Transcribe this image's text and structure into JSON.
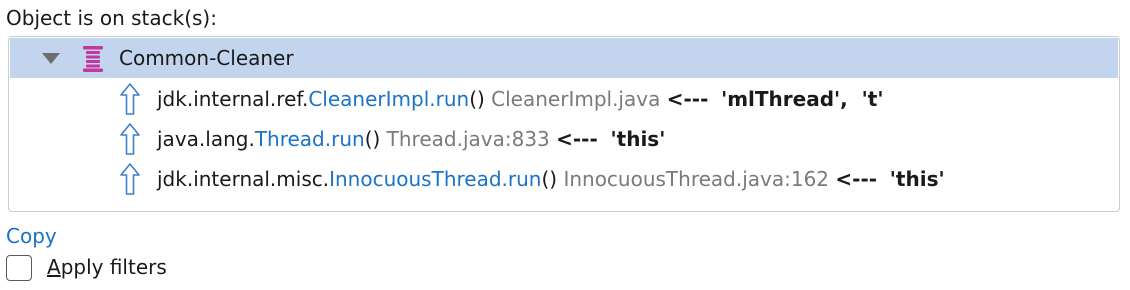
{
  "heading": "Object is on stack(s):",
  "tree": {
    "root": {
      "label": "Common-Cleaner",
      "icon": "thread-stack-icon",
      "expanded": true
    },
    "frames": [
      {
        "package": "jdk.internal.ref.",
        "method": "CleanerImpl.run",
        "parens": "()",
        "location": "CleanerImpl.java",
        "arrow": "<---",
        "refs": "'mlThread',  't'"
      },
      {
        "package": "java.lang.",
        "method": "Thread.run",
        "parens": "()",
        "location": "Thread.java:833",
        "arrow": "<---",
        "refs": "'this'"
      },
      {
        "package": "jdk.internal.misc.",
        "method": "InnocuousThread.run",
        "parens": "()",
        "location": "InnocuousThread.java:162",
        "arrow": "<---",
        "refs": "'this'"
      }
    ]
  },
  "copy_link": "Copy",
  "apply_filters": {
    "mnemonic": "A",
    "rest": "pply filters",
    "checked": false
  },
  "colors": {
    "selection": "#c3d4ee",
    "link": "#1a73c7",
    "stack_icon": "#c2389c",
    "frame_icon": "#3d7fc9",
    "location": "#7a7a7a"
  }
}
